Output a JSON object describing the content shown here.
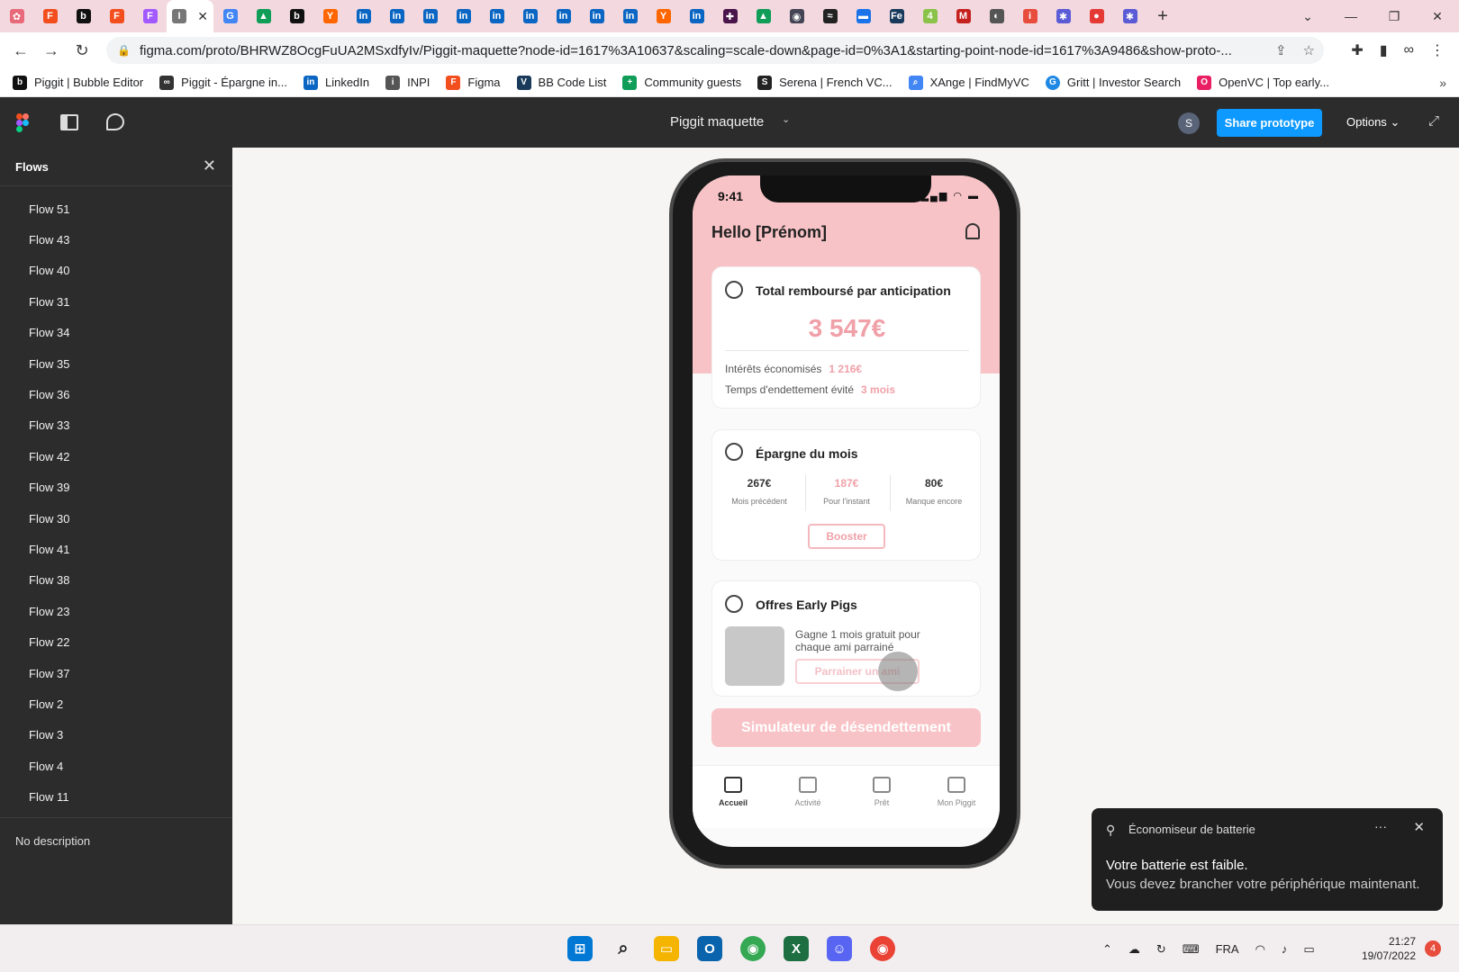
{
  "browser": {
    "url": "figma.com/proto/BHRWZ8OcgFuUA2MSxdfyIv/Piggit-maquette?node-id=1617%3A10637&scaling=scale-down&page-id=0%3A1&starting-point-node-id=1617%3A9486&show-proto-...",
    "bookmarks": [
      {
        "label": "Piggit | Bubble Editor",
        "icon": "bubble-icon",
        "color": "#111111"
      },
      {
        "label": "Piggit - Épargne in...",
        "icon": "link-icon",
        "color": "#333333"
      },
      {
        "label": "LinkedIn",
        "icon": "linkedin-icon",
        "color": "#0a66c2"
      },
      {
        "label": "INPI",
        "icon": "inpi-icon",
        "color": "#555555"
      },
      {
        "label": "Figma",
        "icon": "figma-icon",
        "color": "#f24e1e"
      },
      {
        "label": "BB Code List",
        "icon": "bbcode-icon",
        "color": "#1a3a5c"
      },
      {
        "label": "Community guests",
        "icon": "plus-icon",
        "color": "#0f9d58"
      },
      {
        "label": "Serena | French VC...",
        "icon": "serena-icon",
        "color": "#222222"
      },
      {
        "label": "XAnge | FindMyVC",
        "icon": "search-icon",
        "color": "#4285f4"
      },
      {
        "label": "Gritt | Investor Search",
        "icon": "gritt-icon",
        "color": "#1e88e5"
      },
      {
        "label": "OpenVC | Top early...",
        "icon": "openvc-icon",
        "color": "#e91e63"
      }
    ],
    "more": "»"
  },
  "figma": {
    "file_title": "Piggit maquette",
    "avatar_initial": "S",
    "share_label": "Share prototype",
    "options_label": "Options"
  },
  "sidebar": {
    "title": "Flows",
    "flows": [
      "Flow 51",
      "Flow 43",
      "Flow 40",
      "Flow 31",
      "Flow 34",
      "Flow 35",
      "Flow 36",
      "Flow 33",
      "Flow 42",
      "Flow 39",
      "Flow 30",
      "Flow 41",
      "Flow 38",
      "Flow 23",
      "Flow 22",
      "Flow 37",
      "Flow 2",
      "Flow 3",
      "Flow 4",
      "Flow 11"
    ],
    "description": "No description"
  },
  "phone": {
    "status_time": "9:41",
    "greeting": "Hello [Prénom]",
    "card1": {
      "title": "Total remboursé par anticipation",
      "amount": "3 547€",
      "line1_label": "Intérêts économisés",
      "line1_value": "1 216€",
      "line2_label": "Temps d'endettement évité",
      "line2_value": "3 mois"
    },
    "card2": {
      "title": "Épargne du mois",
      "cols": [
        {
          "value": "267€",
          "label": "Mois précédent"
        },
        {
          "value": "187€",
          "label": "Pour l'instant"
        },
        {
          "value": "80€",
          "label": "Manque encore"
        }
      ],
      "button": "Booster"
    },
    "card3": {
      "title": "Offres Early Pigs",
      "text": "Gagne 1 mois gratuit pour chaque ami parrainé",
      "button": "Parrainer un ami"
    },
    "cta": "Simulateur de désendettement",
    "tabs": [
      "Accueil",
      "Activité",
      "Prêt",
      "Mon Piggit"
    ],
    "accent": "#f0a0a8",
    "header_bg": "#f8c3c6"
  },
  "toast": {
    "app": "Économiseur de batterie",
    "line1": "Votre batterie est faible.",
    "line2": "Vous devez brancher votre périphérique maintenant."
  },
  "taskbar": {
    "lang": "FRA",
    "time": "21:27",
    "date": "19/07/2022",
    "notifications": "4"
  }
}
